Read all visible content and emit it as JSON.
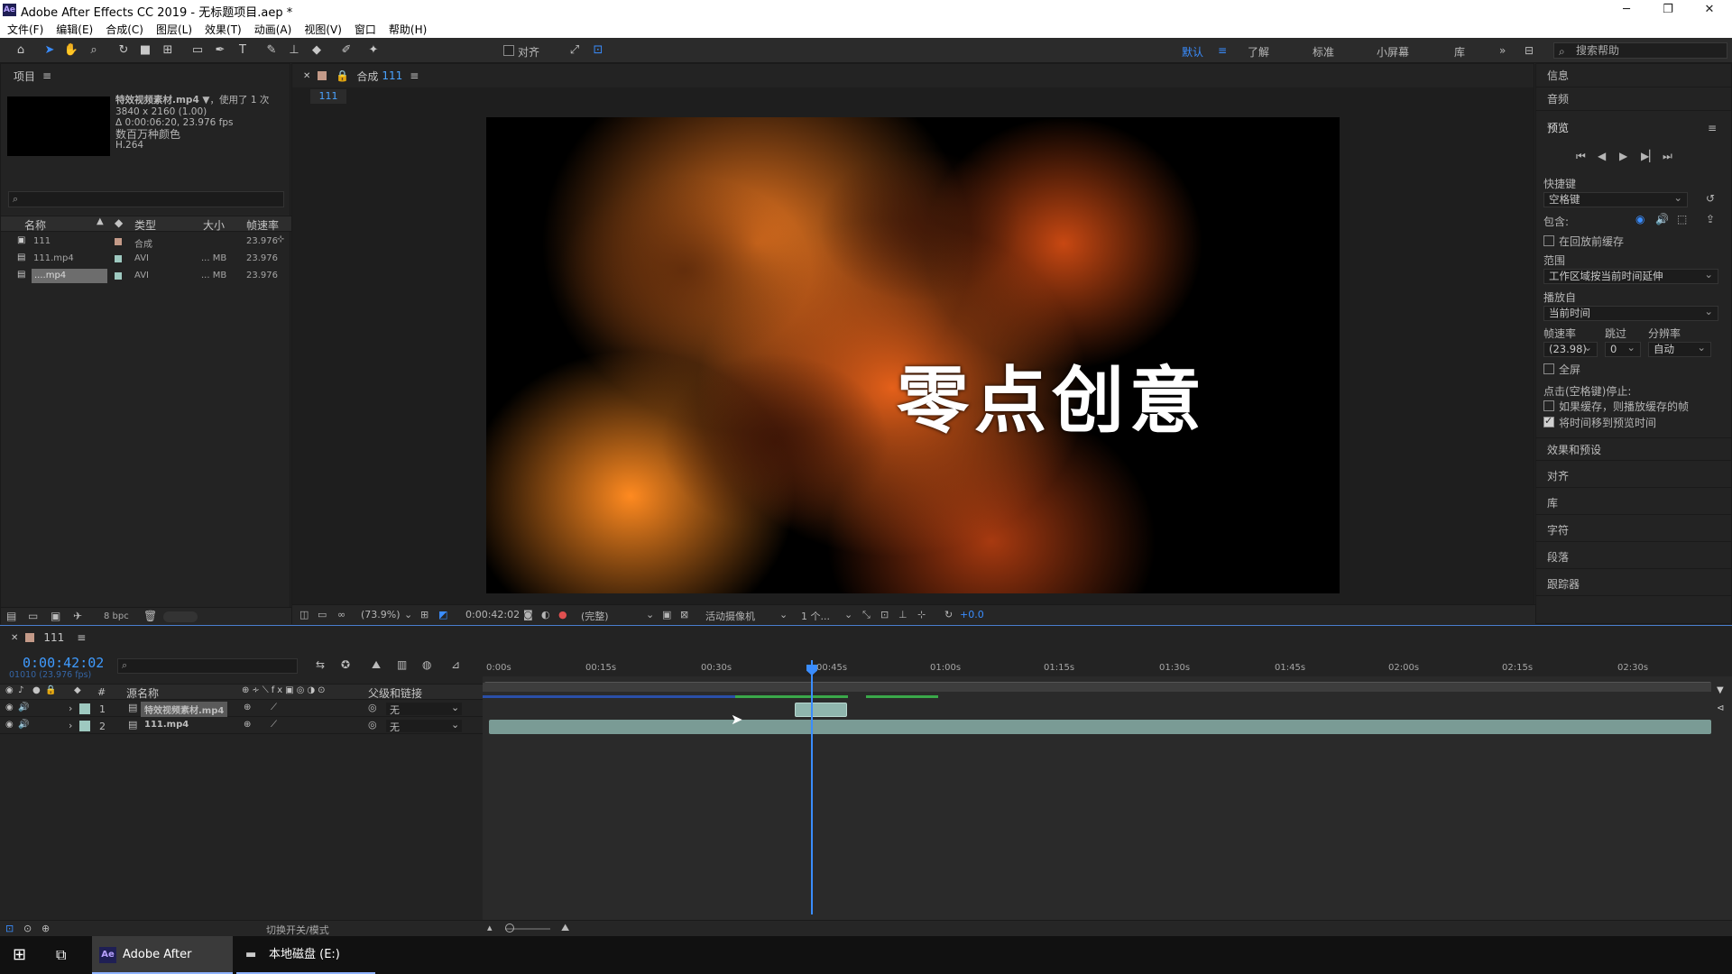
{
  "window": {
    "title": "Adobe After Effects CC 2019 - 无标题项目.aep *",
    "logo": "Ae"
  },
  "menu": [
    "文件(F)",
    "编辑(E)",
    "合成(C)",
    "图层(L)",
    "效果(T)",
    "动画(A)",
    "视图(V)",
    "窗口",
    "帮助(H)"
  ],
  "toolbar": {
    "align_label": "对齐",
    "workspaces": [
      "默认",
      "了解",
      "标准",
      "小屏幕",
      "库"
    ],
    "search_placeholder": "搜索帮助"
  },
  "project": {
    "title": "项目",
    "selected_name": "特效视频素材.mp4 ▼",
    "used": "，使用了 1 次",
    "resolution": "3840 x 2160 (1.00)",
    "duration": "Δ 0:00:06:20, 23.976 fps",
    "color": "数百万种颜色",
    "codec": "H.264",
    "columns": [
      "名称",
      "类型",
      "大小",
      "帧速率"
    ],
    "items": [
      {
        "name": "111",
        "type": "合成",
        "size": "",
        "fps": "23.976"
      },
      {
        "name": "111.mp4",
        "type": "AVI",
        "size": "... MB",
        "fps": "23.976"
      },
      {
        "name": "....mp4",
        "type": "AVI",
        "size": "... MB",
        "fps": "23.976"
      }
    ],
    "bpc": "8 bpc"
  },
  "composition": {
    "panel_label": "合成",
    "name": "111",
    "tab": "111",
    "viewer_text": "零点创意",
    "zoom": "(73.9%)",
    "timecode": "0:00:42:02",
    "quality": "(完整)",
    "camera": "活动摄像机",
    "views": "1 个...",
    "exposure": "+0.0"
  },
  "right_panel": {
    "sections_top": [
      "信息",
      "音频",
      "预览"
    ],
    "shortcut_label": "快捷键",
    "shortcut_value": "空格键",
    "include_label": "包含:",
    "cache_before": "在回放前缓存",
    "range_label": "范围",
    "range_value": "工作区域按当前时间延伸",
    "play_from_label": "播放自",
    "play_from_value": "当前时间",
    "fps_label": "帧速率",
    "skip_label": "跳过",
    "res_label": "分辨率",
    "fps_value": "(23.98)",
    "skip_value": "0",
    "res_value": "自动",
    "fullscreen": "全屏",
    "stop_label": "点击(空格键)停止:",
    "stop_opt1": "如果缓存，则播放缓存的帧",
    "stop_opt2": "将时间移到预览时间",
    "sections_bottom": [
      "效果和预设",
      "对齐",
      "库",
      "字符",
      "段落",
      "跟踪器"
    ]
  },
  "timeline": {
    "comp_name": "111",
    "timecode": "0:00:42:02",
    "fps_info": "01010 (23.976 fps)",
    "col_source": "源名称",
    "col_parent": "父级和链接",
    "col_hash": "#",
    "layers": [
      {
        "num": "1",
        "name": "特效视频素材.mp4",
        "parent": "无"
      },
      {
        "num": "2",
        "name": "111.mp4",
        "parent": "无"
      }
    ],
    "ticks": [
      "0:00s",
      "00:15s",
      "00:30s",
      "00:45s",
      "01:00s",
      "01:15s",
      "01:30s",
      "01:45s",
      "02:00s",
      "02:15s",
      "02:30s"
    ],
    "toggle_label": "切换开关/模式"
  },
  "taskbar": {
    "ae_label": "Adobe After Effec...",
    "disk_label": "本地磁盘 (E:)"
  }
}
